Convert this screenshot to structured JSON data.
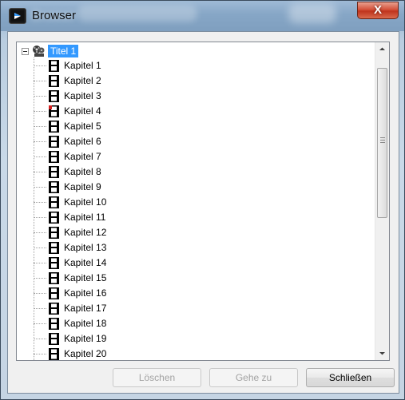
{
  "window": {
    "title": "Browser",
    "close_label": "X"
  },
  "tree": {
    "root": {
      "label": "Titel 1",
      "expanded": true,
      "selected": true
    },
    "chapters": [
      {
        "label": "Kapitel 1",
        "marker": false
      },
      {
        "label": "Kapitel 2",
        "marker": false
      },
      {
        "label": "Kapitel 3",
        "marker": false
      },
      {
        "label": "Kapitel 4",
        "marker": true
      },
      {
        "label": "Kapitel 5",
        "marker": false
      },
      {
        "label": "Kapitel 6",
        "marker": false
      },
      {
        "label": "Kapitel 7",
        "marker": false
      },
      {
        "label": "Kapitel 8",
        "marker": false
      },
      {
        "label": "Kapitel 9",
        "marker": false
      },
      {
        "label": "Kapitel 10",
        "marker": false
      },
      {
        "label": "Kapitel 11",
        "marker": false
      },
      {
        "label": "Kapitel 12",
        "marker": false
      },
      {
        "label": "Kapitel 13",
        "marker": false
      },
      {
        "label": "Kapitel 14",
        "marker": false
      },
      {
        "label": "Kapitel 15",
        "marker": false
      },
      {
        "label": "Kapitel 16",
        "marker": false
      },
      {
        "label": "Kapitel 17",
        "marker": false
      },
      {
        "label": "Kapitel 18",
        "marker": false
      },
      {
        "label": "Kapitel 19",
        "marker": false
      },
      {
        "label": "Kapitel 20",
        "marker": false
      }
    ]
  },
  "buttons": {
    "delete_label": "Löschen",
    "delete_enabled": false,
    "goto_label": "Gehe zu",
    "goto_enabled": false,
    "close_label": "Schließen",
    "close_enabled": true
  },
  "colors": {
    "selection": "#3399ff",
    "marker": "#d42020"
  }
}
